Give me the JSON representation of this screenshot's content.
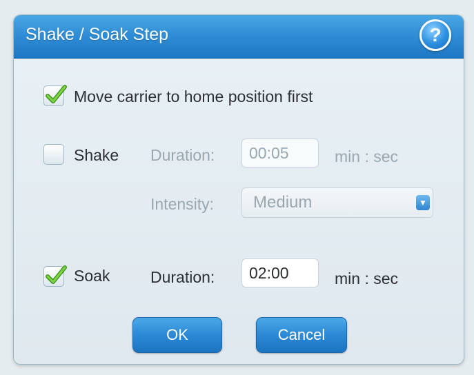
{
  "dialog": {
    "title": "Shake / Soak Step",
    "help_label": "?"
  },
  "move_carrier": {
    "checked": true,
    "label": "Move carrier to home position first"
  },
  "shake": {
    "checked": false,
    "label": "Shake",
    "duration_label": "Duration:",
    "duration_value": "00:05",
    "duration_unit": "min : sec",
    "intensity_label": "Intensity:",
    "intensity_value": "Medium"
  },
  "soak": {
    "checked": true,
    "label": "Soak",
    "duration_label": "Duration:",
    "duration_value": "02:00",
    "duration_unit": "min : sec"
  },
  "buttons": {
    "ok": "OK",
    "cancel": "Cancel"
  },
  "icons": {
    "help": "help-icon",
    "checkmark": "checkmark-icon",
    "dropdown": "chevron-down-icon"
  },
  "colors": {
    "accent": "#2f8ed6",
    "check": "#4caf1f"
  }
}
